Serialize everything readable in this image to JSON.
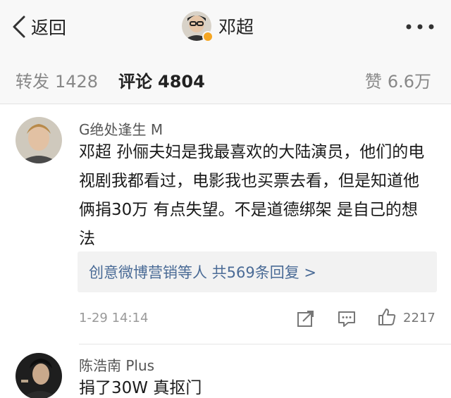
{
  "nav": {
    "back_label": "返回",
    "title": "邓超",
    "avatar_badge_color": "#f5a623",
    "icons": {
      "back": "chevron-left-icon",
      "more": "more-dots-icon"
    }
  },
  "tabs": [
    {
      "label": "转发",
      "count": "1428",
      "active": false
    },
    {
      "label": "评论",
      "count": "4804",
      "active": true
    },
    {
      "label": "赞",
      "count": "6.6万",
      "active": false
    }
  ],
  "comments": [
    {
      "username": "G绝处逢生 M",
      "text": "邓超 孙俪夫妇是我最喜欢的大陆演员，他们的电视剧我都看过，电影我也买票去看，但是知道他俩捐30万 有点失望。不是道德绑架 是自己的想法",
      "reply_summary": "创意微博营销等人 共569条回复 >",
      "time": "1-29 14:14",
      "likes": "2217",
      "icons": [
        "share-icon",
        "comment-icon",
        "thumbs-up-icon"
      ]
    },
    {
      "username": "陈浩南 Plus",
      "text": "捐了30W 真抠门"
    }
  ],
  "colors": {
    "link_blue": "#4a6b96",
    "tab_active": "#222222",
    "tab_inactive": "#888888"
  }
}
